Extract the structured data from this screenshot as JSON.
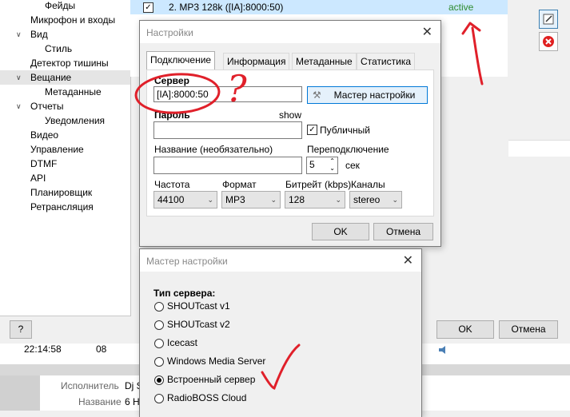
{
  "tree": {
    "items": [
      {
        "label": "Фейды",
        "indent": 2,
        "arrow": ""
      },
      {
        "label": "Микрофон и входы",
        "indent": 1,
        "arrow": ""
      },
      {
        "label": "Вид",
        "indent": 1,
        "arrow": "∨"
      },
      {
        "label": "Стиль",
        "indent": 2,
        "arrow": ""
      },
      {
        "label": "Детектор тишины",
        "indent": 1,
        "arrow": ""
      },
      {
        "label": "Вещание",
        "indent": 1,
        "arrow": "∨",
        "selected": true
      },
      {
        "label": "Метаданные",
        "indent": 2,
        "arrow": ""
      },
      {
        "label": "Отчеты",
        "indent": 1,
        "arrow": "∨"
      },
      {
        "label": "Уведомления",
        "indent": 2,
        "arrow": ""
      },
      {
        "label": "Видео",
        "indent": 1,
        "arrow": ""
      },
      {
        "label": "Управление",
        "indent": 1,
        "arrow": ""
      },
      {
        "label": "DTMF",
        "indent": 1,
        "arrow": ""
      },
      {
        "label": "API",
        "indent": 1,
        "arrow": ""
      },
      {
        "label": "Планировщик",
        "indent": 1,
        "arrow": ""
      },
      {
        "label": "Ретрансляция",
        "indent": 1,
        "arrow": ""
      }
    ]
  },
  "server_list": {
    "row_label": "2. MP3 128k ([IA]:8000:50)",
    "row_status": "active",
    "status_color": "#2e8b2e"
  },
  "main_buttons": {
    "help": "?",
    "ok": "OK",
    "cancel": "Отмена"
  },
  "log": {
    "time": "22:14:58",
    "value": "08"
  },
  "bottom": {
    "artist_label": "Исполнитель",
    "artist_value": "Dj S",
    "title_label": "Название",
    "title_value": "6 Н"
  },
  "settings_dialog": {
    "title": "Настройки",
    "tabs": [
      "Подключение",
      "Информация",
      "Метаданные",
      "Статистика"
    ],
    "server_label": "Сервер",
    "server_value": "[IA]:8000:50",
    "wizard_button": "Мастер настройки",
    "password_label": "Пароль",
    "password_show": "show",
    "password_value": "",
    "public_label": "Публичный",
    "name_label": "Название (необязательно)",
    "name_value": "",
    "reconnect_label": "Переподключение",
    "reconnect_value": "5",
    "reconnect_unit": "сек",
    "freq_label": "Частота",
    "freq_value": "44100",
    "format_label": "Формат",
    "format_value": "MP3",
    "bitrate_label": "Битрейт (kbps)",
    "bitrate_value": "128",
    "channels_label": "Каналы",
    "channels_value": "stereo",
    "ok": "OK",
    "cancel": "Отмена"
  },
  "wizard_dialog": {
    "title": "Мастер настройки",
    "type_label": "Тип сервера:",
    "options": [
      "SHOUTcast v1",
      "SHOUTcast v2",
      "Icecast",
      "Windows Media Server",
      "Встроенный сервер",
      "RadioBOSS Cloud"
    ],
    "selected_index": 4
  },
  "annotations": {
    "question": "?",
    "color": "#e0202a"
  }
}
